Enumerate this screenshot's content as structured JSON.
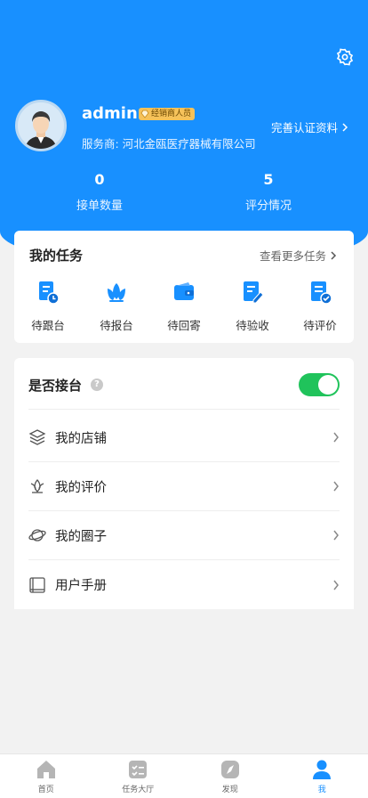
{
  "profile": {
    "username": "admin",
    "role_badge": "经销商人员",
    "provider": "服务商: 河北金瓯医疗器械有限公司",
    "complete_link": "完善认证资料"
  },
  "stats": [
    {
      "value": "0",
      "label": "接单数量"
    },
    {
      "value": "5",
      "label": "评分情况"
    }
  ],
  "tasks": {
    "title": "我的任务",
    "more_link": "查看更多任务",
    "items": [
      {
        "label": "待跟台",
        "icon": "schedule-icon"
      },
      {
        "label": "待报台",
        "icon": "lotus-icon"
      },
      {
        "label": "待回寄",
        "icon": "wallet-icon"
      },
      {
        "label": "待验收",
        "icon": "edit-doc-icon"
      },
      {
        "label": "待评价",
        "icon": "check-doc-icon"
      }
    ]
  },
  "menu": {
    "accept_label": "是否接台",
    "accept_enabled": true,
    "items": [
      {
        "label": "我的店铺",
        "icon": "layers-icon"
      },
      {
        "label": "我的评价",
        "icon": "lotus-outline-icon"
      },
      {
        "label": "我的圈子",
        "icon": "planet-icon"
      },
      {
        "label": "用户手册",
        "icon": "book-icon"
      }
    ]
  },
  "tabbar": [
    {
      "label": "首页",
      "icon": "home-icon",
      "active": false
    },
    {
      "label": "任务大厅",
      "icon": "task-list-icon",
      "active": false
    },
    {
      "label": "发现",
      "icon": "compass-icon",
      "active": false
    },
    {
      "label": "我",
      "icon": "person-icon",
      "active": true
    }
  ],
  "colors": {
    "primary": "#1890ff",
    "toggle_on": "#20c35b",
    "badge": "#f6c25a"
  }
}
